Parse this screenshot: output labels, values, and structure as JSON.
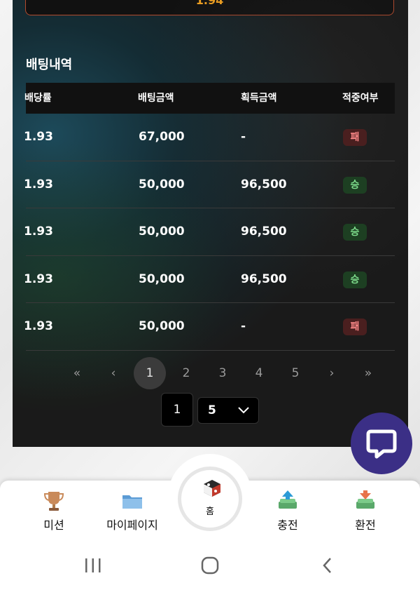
{
  "top_odds": "1.94",
  "section_title": "배팅내역",
  "table": {
    "headers": [
      "배당률",
      "배팅금액",
      "획득금액",
      "적중여부"
    ],
    "rows": [
      {
        "odds": "1.93",
        "bet": "67,000",
        "payout": "-",
        "result": "패",
        "status": "lose"
      },
      {
        "odds": "1.93",
        "bet": "50,000",
        "payout": "96,500",
        "result": "승",
        "status": "win"
      },
      {
        "odds": "1.93",
        "bet": "50,000",
        "payout": "96,500",
        "result": "승",
        "status": "win"
      },
      {
        "odds": "1.93",
        "bet": "50,000",
        "payout": "96,500",
        "result": "승",
        "status": "win"
      },
      {
        "odds": "1.93",
        "bet": "50,000",
        "payout": "-",
        "result": "패",
        "status": "lose"
      }
    ]
  },
  "pagination": {
    "first": "«",
    "prev": "‹",
    "pages": [
      "1",
      "2",
      "3",
      "4",
      "5"
    ],
    "current": "1",
    "next": "›",
    "last": "»"
  },
  "page_input_value": "1",
  "page_size_value": "5",
  "bottom_nav": {
    "mission": "미션",
    "mypage": "마이페이지",
    "home": "홈",
    "deposit": "충전",
    "withdraw": "환전"
  },
  "colors": {
    "accent_orange": "#f0a020",
    "win_green": "#7ddb8b",
    "lose_red": "#ff8a8a",
    "chat_purple": "#3b2f86"
  }
}
